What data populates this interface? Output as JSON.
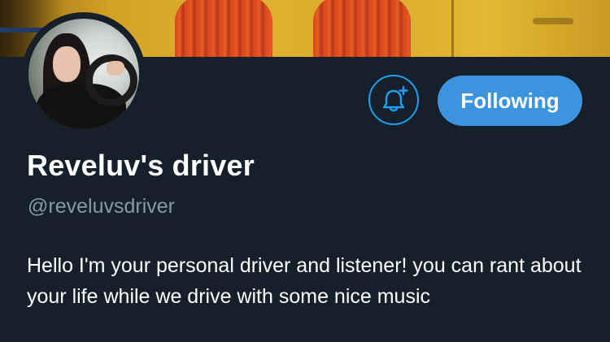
{
  "banner": {
    "description_icon": "banner-image"
  },
  "avatar": {
    "icon": "profile-photo"
  },
  "actions": {
    "notify_icon": "bell-plus-icon",
    "follow_label": "Following"
  },
  "profile": {
    "display_name": "Reveluv's driver",
    "handle": "@reveluvsdriver",
    "bio": "Hello I'm your personal driver and listener! you can rant about your life while we drive with some nice music"
  },
  "colors": {
    "background": "#15202b",
    "accent": "#1da1f2",
    "follow_button": "#3b94dd",
    "secondary_text": "#8899a6"
  }
}
